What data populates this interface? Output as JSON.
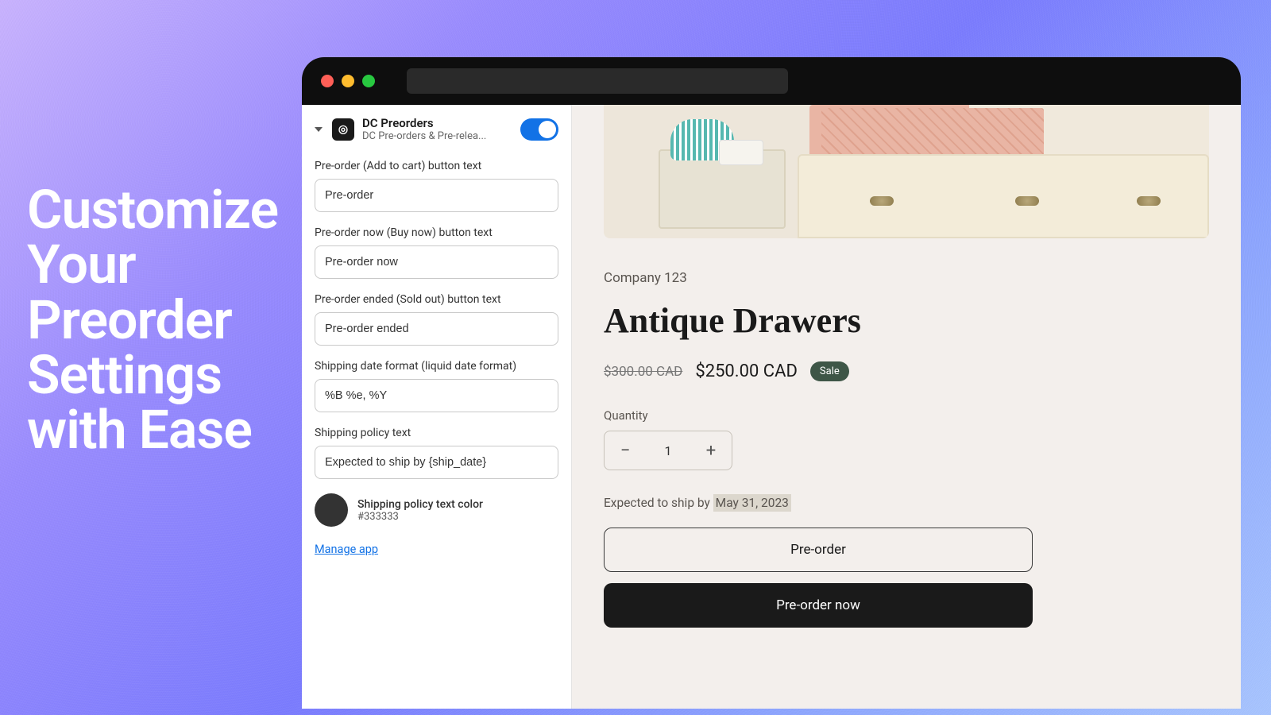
{
  "hero": {
    "line1": "Customize",
    "line2": "Your",
    "line3": "Preorder",
    "line4": "Settings",
    "line5": "with Ease"
  },
  "app": {
    "title": "DC Preorders",
    "subtitle": "DC Pre-orders & Pre-relea...",
    "toggle_on": true
  },
  "fields": {
    "add_to_cart": {
      "label": "Pre-order (Add to cart) button text",
      "value": "Pre-order"
    },
    "buy_now": {
      "label": "Pre-order now (Buy now) button text",
      "value": "Pre-order now"
    },
    "sold_out": {
      "label": "Pre-order ended (Sold out) button text",
      "value": "Pre-order ended"
    },
    "date_format": {
      "label": "Shipping date format (liquid date format)",
      "value": "%B %e, %Y"
    },
    "policy_text": {
      "label": "Shipping policy text",
      "value": "Expected to ship by {ship_date}"
    },
    "policy_color": {
      "label": "Shipping policy text color",
      "hex": "#333333"
    }
  },
  "manage_link": "Manage app",
  "product": {
    "vendor": "Company 123",
    "title": "Antique Drawers",
    "price_old": "$300.00 CAD",
    "price_new": "$250.00 CAD",
    "sale_badge": "Sale",
    "qty_label": "Quantity",
    "qty_value": "1",
    "ship_prefix": "Expected to ship by ",
    "ship_date": "May 31, 2023",
    "cta_primary": "Pre-order",
    "cta_secondary": "Pre-order now"
  }
}
